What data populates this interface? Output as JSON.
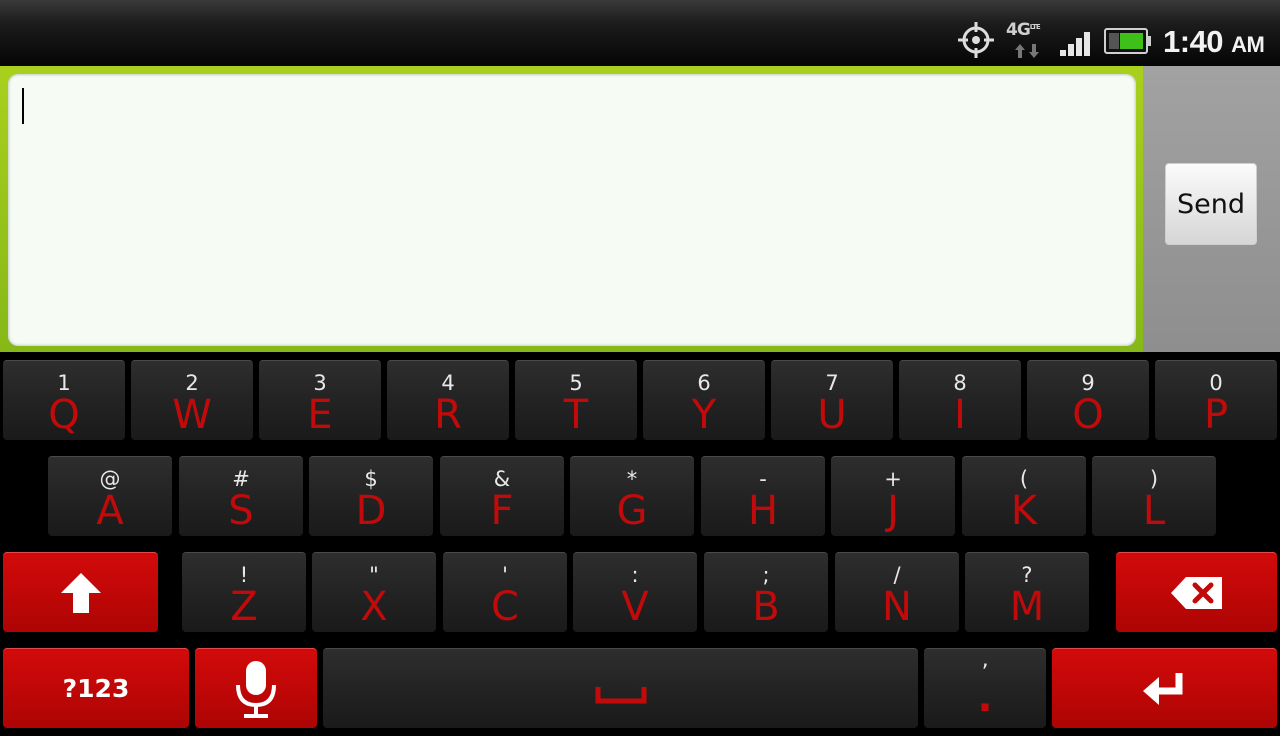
{
  "status_bar": {
    "network_label": "4G",
    "network_sub": "LTE",
    "time": "1:40",
    "ampm": "AM",
    "icons": [
      "gps-icon",
      "data-arrows-icon",
      "signal-icon",
      "battery-icon"
    ],
    "battery_color": "#3fbf1a"
  },
  "compose": {
    "message_value": "",
    "send_label": "Send",
    "frame_color": "#9dc81a"
  },
  "keyboard": {
    "accent_color": "#c30a0a",
    "row1": [
      {
        "top": "1",
        "main": "Q"
      },
      {
        "top": "2",
        "main": "W"
      },
      {
        "top": "3",
        "main": "E"
      },
      {
        "top": "4",
        "main": "R"
      },
      {
        "top": "5",
        "main": "T"
      },
      {
        "top": "6",
        "main": "Y"
      },
      {
        "top": "7",
        "main": "U"
      },
      {
        "top": "8",
        "main": "I"
      },
      {
        "top": "9",
        "main": "O"
      },
      {
        "top": "0",
        "main": "P"
      }
    ],
    "row2": [
      {
        "top": "@",
        "main": "A"
      },
      {
        "top": "#",
        "main": "S"
      },
      {
        "top": "$",
        "main": "D"
      },
      {
        "top": "&",
        "main": "F"
      },
      {
        "top": "*",
        "main": "G"
      },
      {
        "top": "-",
        "main": "H"
      },
      {
        "top": "+",
        "main": "J"
      },
      {
        "top": "(",
        "main": "K"
      },
      {
        "top": ")",
        "main": "L"
      }
    ],
    "row3": [
      {
        "top": "!",
        "main": "Z"
      },
      {
        "top": "\"",
        "main": "X"
      },
      {
        "top": "'",
        "main": "C"
      },
      {
        "top": ":",
        "main": "V"
      },
      {
        "top": ";",
        "main": "B"
      },
      {
        "top": "/",
        "main": "N"
      },
      {
        "top": "?",
        "main": "M"
      }
    ],
    "symbols_label": "?123",
    "period_top": "’",
    "period_main": ".",
    "special_icons": [
      "shift-icon",
      "backspace-icon",
      "microphone-icon",
      "space-icon",
      "enter-icon"
    ]
  }
}
